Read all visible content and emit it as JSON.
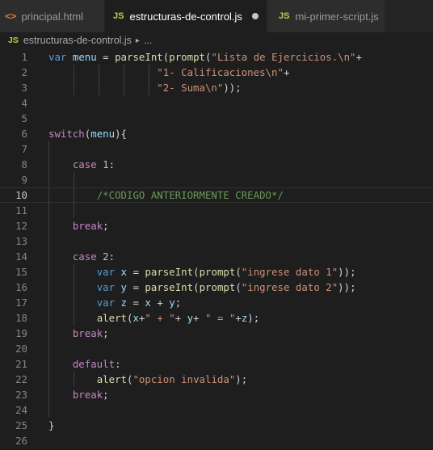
{
  "tabs": [
    {
      "icon": "html-icon",
      "label": "principal.html",
      "active": false
    },
    {
      "icon": "js-icon",
      "label": "estructuras-de-control.js",
      "active": true,
      "unsaved": true
    },
    {
      "icon": "js-icon",
      "label": "mi-primer-script.js",
      "active": false
    }
  ],
  "icon_text": {
    "html": "<>",
    "js": "JS"
  },
  "breadcrumb": {
    "file": "estructuras-de-control.js",
    "more": "..."
  },
  "colors": {
    "background": "#1e1e1e",
    "keyword": "#569cd6",
    "control": "#c586c0",
    "variable": "#9cdcfe",
    "function": "#dcdcaa",
    "string": "#ce9178",
    "number": "#b5cea8",
    "comment": "#6a9955"
  },
  "editor": {
    "current_line": 10,
    "lines": [
      {
        "n": "1",
        "indent": 0,
        "tokens": [
          [
            "kw",
            "var"
          ],
          [
            "plain",
            " "
          ],
          [
            "var",
            "menu"
          ],
          [
            "plain",
            " = "
          ],
          [
            "fn",
            "parseInt"
          ],
          [
            "plain",
            "("
          ],
          [
            "fn",
            "prompt"
          ],
          [
            "plain",
            "("
          ],
          [
            "str",
            "\"Lista de Ejercicios.\\n\""
          ],
          [
            "plain",
            "+"
          ]
        ]
      },
      {
        "n": "2",
        "indent": 0,
        "tokens": [
          [
            "plain",
            "                  "
          ],
          [
            "str",
            "\"1- Calificaciones\\n\""
          ],
          [
            "plain",
            "+"
          ]
        ]
      },
      {
        "n": "3",
        "indent": 0,
        "tokens": [
          [
            "plain",
            "                  "
          ],
          [
            "str",
            "\"2- Suma\\n\""
          ],
          [
            "plain",
            "));"
          ]
        ]
      },
      {
        "n": "4",
        "indent": 0,
        "tokens": []
      },
      {
        "n": "5",
        "indent": 0,
        "tokens": []
      },
      {
        "n": "6",
        "indent": 0,
        "tokens": [
          [
            "ctl",
            "switch"
          ],
          [
            "plain",
            "("
          ],
          [
            "var",
            "menu"
          ],
          [
            "plain",
            "){"
          ]
        ]
      },
      {
        "n": "7",
        "indent": 0,
        "tokens": []
      },
      {
        "n": "8",
        "indent": 0,
        "tokens": [
          [
            "plain",
            "    "
          ],
          [
            "ctl",
            "case"
          ],
          [
            "plain",
            " "
          ],
          [
            "num",
            "1"
          ],
          [
            "plain",
            ":"
          ]
        ]
      },
      {
        "n": "9",
        "indent": 0,
        "tokens": []
      },
      {
        "n": "10",
        "indent": 0,
        "tokens": [
          [
            "plain",
            "        "
          ],
          [
            "cmt",
            "/*CODIGO ANTERIORMENTE CREADO*/"
          ]
        ]
      },
      {
        "n": "11",
        "indent": 0,
        "tokens": []
      },
      {
        "n": "12",
        "indent": 0,
        "tokens": [
          [
            "plain",
            "    "
          ],
          [
            "ctl",
            "break"
          ],
          [
            "plain",
            ";"
          ]
        ]
      },
      {
        "n": "13",
        "indent": 0,
        "tokens": []
      },
      {
        "n": "14",
        "indent": 0,
        "tokens": [
          [
            "plain",
            "    "
          ],
          [
            "ctl",
            "case"
          ],
          [
            "plain",
            " "
          ],
          [
            "num",
            "2"
          ],
          [
            "plain",
            ":"
          ]
        ]
      },
      {
        "n": "15",
        "indent": 0,
        "tokens": [
          [
            "plain",
            "        "
          ],
          [
            "kw",
            "var"
          ],
          [
            "plain",
            " "
          ],
          [
            "var",
            "x"
          ],
          [
            "plain",
            " = "
          ],
          [
            "fn",
            "parseInt"
          ],
          [
            "plain",
            "("
          ],
          [
            "fn",
            "prompt"
          ],
          [
            "plain",
            "("
          ],
          [
            "str",
            "\"ingrese dato 1\""
          ],
          [
            "plain",
            "));"
          ]
        ]
      },
      {
        "n": "16",
        "indent": 0,
        "tokens": [
          [
            "plain",
            "        "
          ],
          [
            "kw",
            "var"
          ],
          [
            "plain",
            " "
          ],
          [
            "var",
            "y"
          ],
          [
            "plain",
            " = "
          ],
          [
            "fn",
            "parseInt"
          ],
          [
            "plain",
            "("
          ],
          [
            "fn",
            "prompt"
          ],
          [
            "plain",
            "("
          ],
          [
            "str",
            "\"ingrese dato 2\""
          ],
          [
            "plain",
            "));"
          ]
        ]
      },
      {
        "n": "17",
        "indent": 0,
        "tokens": [
          [
            "plain",
            "        "
          ],
          [
            "kw",
            "var"
          ],
          [
            "plain",
            " "
          ],
          [
            "var",
            "z"
          ],
          [
            "plain",
            " = "
          ],
          [
            "var",
            "x"
          ],
          [
            "plain",
            " + "
          ],
          [
            "var",
            "y"
          ],
          [
            "plain",
            ";"
          ]
        ]
      },
      {
        "n": "18",
        "indent": 0,
        "tokens": [
          [
            "plain",
            "        "
          ],
          [
            "fn",
            "alert"
          ],
          [
            "plain",
            "("
          ],
          [
            "var",
            "x"
          ],
          [
            "plain",
            "+"
          ],
          [
            "str",
            "\" + \""
          ],
          [
            "plain",
            "+ "
          ],
          [
            "var",
            "y"
          ],
          [
            "plain",
            "+ "
          ],
          [
            "str",
            "\" = \""
          ],
          [
            "plain",
            "+"
          ],
          [
            "var",
            "z"
          ],
          [
            "plain",
            ");"
          ]
        ]
      },
      {
        "n": "19",
        "indent": 0,
        "tokens": [
          [
            "plain",
            "    "
          ],
          [
            "ctl",
            "break"
          ],
          [
            "plain",
            ";"
          ]
        ]
      },
      {
        "n": "20",
        "indent": 0,
        "tokens": []
      },
      {
        "n": "21",
        "indent": 0,
        "tokens": [
          [
            "plain",
            "    "
          ],
          [
            "ctl",
            "default"
          ],
          [
            "plain",
            ":"
          ]
        ]
      },
      {
        "n": "22",
        "indent": 0,
        "tokens": [
          [
            "plain",
            "        "
          ],
          [
            "fn",
            "alert"
          ],
          [
            "plain",
            "("
          ],
          [
            "str",
            "\"opcion invalida\""
          ],
          [
            "plain",
            ");"
          ]
        ]
      },
      {
        "n": "23",
        "indent": 0,
        "tokens": [
          [
            "plain",
            "    "
          ],
          [
            "ctl",
            "break"
          ],
          [
            "plain",
            ";"
          ]
        ]
      },
      {
        "n": "24",
        "indent": 0,
        "tokens": []
      },
      {
        "n": "25",
        "indent": 0,
        "tokens": [
          [
            "plain",
            "}"
          ]
        ]
      },
      {
        "n": "26",
        "indent": 0,
        "tokens": []
      }
    ]
  }
}
